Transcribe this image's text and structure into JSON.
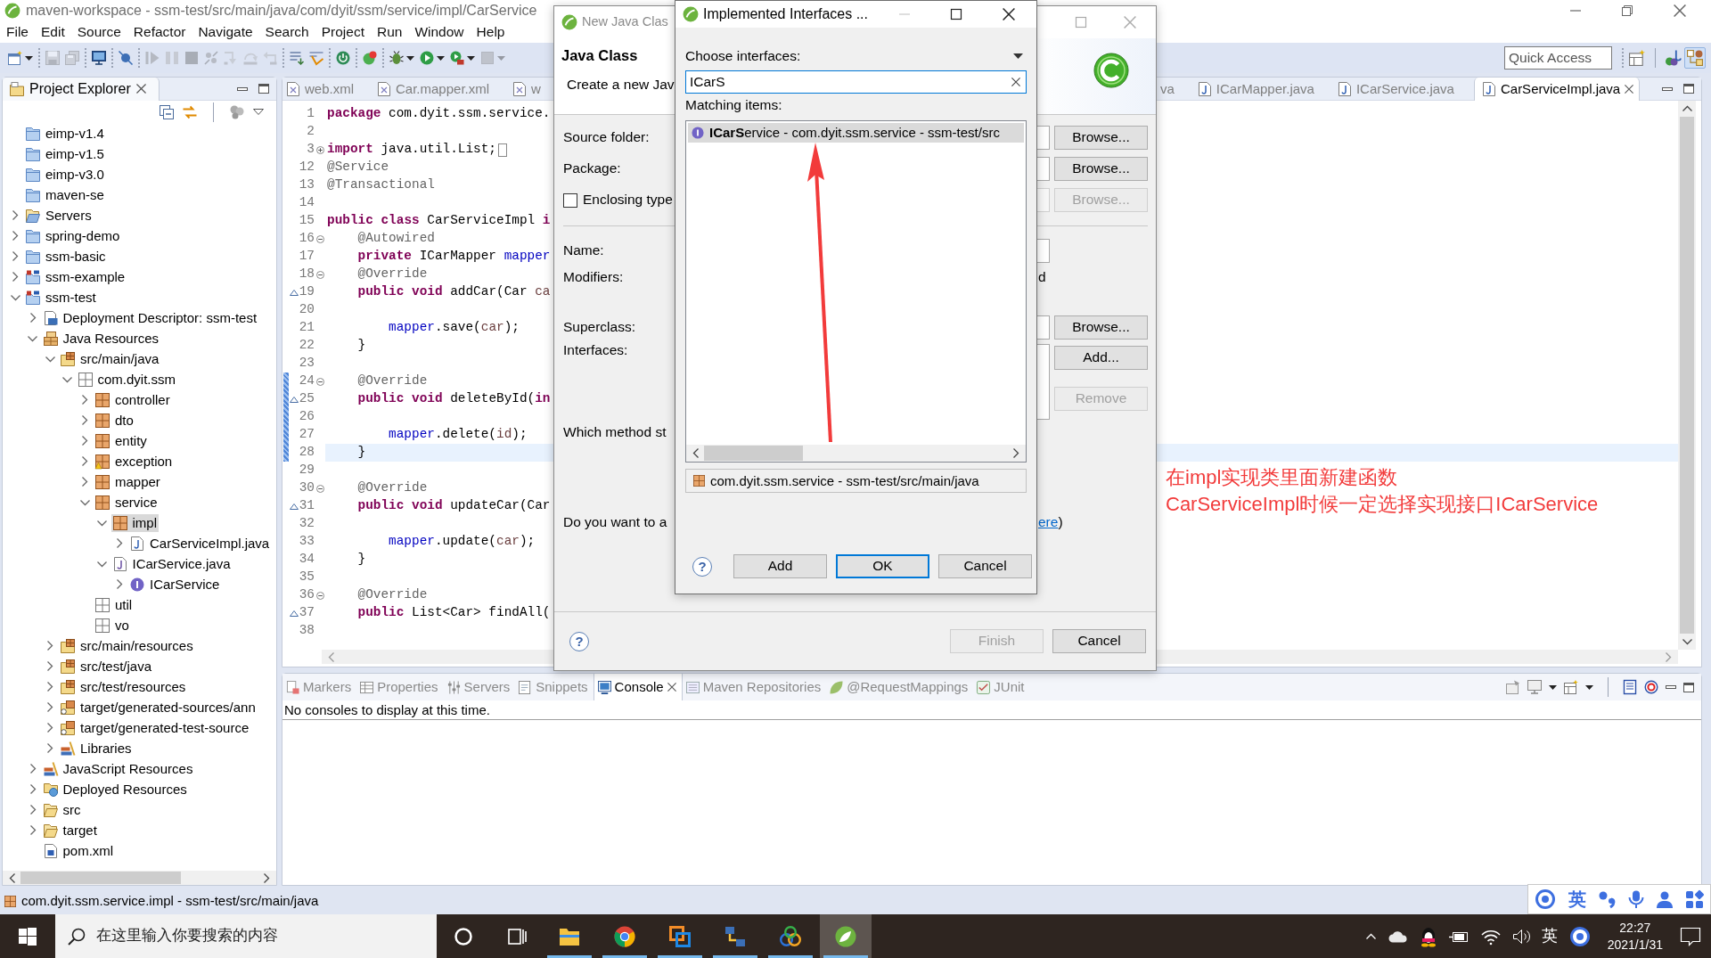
{
  "window": {
    "title": "maven-workspace - ssm-test/src/main/java/com/dyit/ssm/service/impl/CarService"
  },
  "menu": [
    "File",
    "Edit",
    "Source",
    "Refactor",
    "Navigate",
    "Search",
    "Project",
    "Run",
    "Window",
    "Help"
  ],
  "toolbar": [
    {
      "kind": "new",
      "dropdown": true,
      "disabled": false
    },
    {
      "kind": "separator"
    },
    {
      "kind": "save",
      "dropdown": false,
      "disabled": true
    },
    {
      "kind": "save-all",
      "dropdown": false,
      "disabled": true
    },
    {
      "kind": "separator"
    },
    {
      "kind": "terminal",
      "dropdown": false,
      "disabled": false
    },
    {
      "kind": "separator"
    },
    {
      "kind": "skip-breakpoints",
      "dropdown": false,
      "disabled": false
    },
    {
      "kind": "separator"
    },
    {
      "kind": "resume",
      "dropdown": false,
      "disabled": true
    },
    {
      "kind": "suspend",
      "dropdown": false,
      "disabled": true
    },
    {
      "kind": "terminate",
      "dropdown": false,
      "disabled": true
    },
    {
      "kind": "disconnect",
      "dropdown": false,
      "disabled": true
    },
    {
      "kind": "step-into",
      "dropdown": false,
      "disabled": true
    },
    {
      "kind": "step-over",
      "dropdown": false,
      "disabled": true
    },
    {
      "kind": "step-return",
      "dropdown": false,
      "disabled": true
    },
    {
      "kind": "separator"
    },
    {
      "kind": "drop-to-frame",
      "dropdown": false,
      "disabled": false
    },
    {
      "kind": "step-filters",
      "dropdown": false,
      "disabled": false
    },
    {
      "kind": "separator"
    },
    {
      "kind": "boot-dashboard",
      "dropdown": false,
      "disabled": false
    },
    {
      "kind": "separator"
    },
    {
      "kind": "spring-badge",
      "dropdown": false,
      "disabled": false
    },
    {
      "kind": "separator"
    },
    {
      "kind": "debug",
      "dropdown": true,
      "disabled": false
    },
    {
      "kind": "run",
      "dropdown": true,
      "disabled": false
    },
    {
      "kind": "external-tools",
      "dropdown": true,
      "disabled": false
    },
    {
      "kind": "stop-square",
      "dropdown": true,
      "disabled": true
    }
  ],
  "quick_access": {
    "placeholder": "Quick Access"
  },
  "perspectives": [
    {
      "kind": "open-perspective",
      "selected": false
    },
    {
      "kind": "java-ee",
      "selected": false
    },
    {
      "kind": "spring",
      "selected": true
    }
  ],
  "project_explorer": {
    "title": "Project Explorer",
    "tree": [
      {
        "label": "eimp-v1.4",
        "kind": "project",
        "selected": false
      },
      {
        "label": "eimp-v1.5",
        "kind": "project",
        "selected": false
      },
      {
        "label": "eimp-v3.0",
        "kind": "project",
        "selected": false
      },
      {
        "label": "maven-se",
        "kind": "project",
        "selected": false
      },
      {
        "label": "Servers",
        "kind": "servers",
        "expanded": false,
        "selected": false
      },
      {
        "label": "spring-demo",
        "kind": "project",
        "expanded": false,
        "selected": false
      },
      {
        "label": "ssm-basic",
        "kind": "project",
        "expanded": false,
        "selected": false
      },
      {
        "label": "ssm-example",
        "kind": "maven-project",
        "expanded": false,
        "selected": false
      },
      {
        "label": "ssm-test",
        "kind": "maven-project",
        "expanded": true,
        "selected": false,
        "children": [
          {
            "label": "Deployment Descriptor: ssm-test",
            "kind": "descriptor",
            "expanded": false,
            "selected": false
          },
          {
            "label": "Java Resources",
            "kind": "java-resources",
            "expanded": true,
            "selected": false,
            "children": [
              {
                "label": "src/main/java",
                "kind": "source-folder",
                "expanded": true,
                "selected": false,
                "children": [
                  {
                    "label": "com.dyit.ssm",
                    "kind": "empty-package",
                    "expanded": true,
                    "selected": false,
                    "children": [
                      {
                        "label": "controller",
                        "kind": "package",
                        "expanded": false,
                        "selected": false
                      },
                      {
                        "label": "dto",
                        "kind": "package",
                        "expanded": false,
                        "selected": false
                      },
                      {
                        "label": "entity",
                        "kind": "package",
                        "expanded": false,
                        "selected": false
                      },
                      {
                        "label": "exception",
                        "kind": "package-warning",
                        "expanded": false,
                        "selected": false
                      },
                      {
                        "label": "mapper",
                        "kind": "package",
                        "expanded": false,
                        "selected": false
                      },
                      {
                        "label": "service",
                        "kind": "package",
                        "expanded": true,
                        "selected": false,
                        "children": [
                          {
                            "label": "impl",
                            "kind": "package",
                            "expanded": true,
                            "selected": true,
                            "children": [
                              {
                                "label": "CarServiceImpl.java",
                                "kind": "java-file",
                                "expanded": false,
                                "selected": false
                              }
                            ]
                          },
                          {
                            "label": "ICarService.java",
                            "kind": "interface-file",
                            "expanded": true,
                            "selected": false,
                            "children": [
                              {
                                "label": "ICarService",
                                "kind": "interface",
                                "expanded": false,
                                "selected": false
                              }
                            ]
                          }
                        ]
                      },
                      {
                        "label": "util",
                        "kind": "empty-package",
                        "selected": false
                      },
                      {
                        "label": "vo",
                        "kind": "empty-package",
                        "selected": false
                      }
                    ]
                  }
                ]
              },
              {
                "label": "src/main/resources",
                "kind": "source-folder",
                "expanded": false,
                "selected": false
              },
              {
                "label": "src/test/java",
                "kind": "source-folder",
                "expanded": false,
                "selected": false
              },
              {
                "label": "src/test/resources",
                "kind": "source-folder",
                "expanded": false,
                "selected": false
              },
              {
                "label": "target/generated-sources/ann",
                "kind": "linked-source-folder",
                "expanded": false,
                "selected": false
              },
              {
                "label": "target/generated-test-source",
                "kind": "linked-source-folder",
                "expanded": false,
                "selected": false
              },
              {
                "label": "Libraries",
                "kind": "library",
                "expanded": false,
                "selected": false
              }
            ]
          },
          {
            "label": "JavaScript Resources",
            "kind": "library",
            "expanded": false,
            "selected": false
          },
          {
            "label": "Deployed Resources",
            "kind": "deployed",
            "expanded": false,
            "selected": false
          },
          {
            "label": "src",
            "kind": "folder",
            "expanded": false,
            "selected": false
          },
          {
            "label": "target",
            "kind": "folder",
            "expanded": false,
            "selected": false
          },
          {
            "label": "pom.xml",
            "kind": "pom",
            "selected": false
          }
        ]
      }
    ]
  },
  "editor": {
    "tabs_left": [
      {
        "label": "web.xml",
        "kind": "xml",
        "selected": false
      },
      {
        "label": "Car.mapper.xml",
        "kind": "xml",
        "selected": false
      },
      {
        "label": "w",
        "kind": "xml",
        "selected": false
      }
    ],
    "tabs_right": [
      {
        "label": "va",
        "selected": false
      },
      {
        "label": "ICarMapper.java",
        "kind": "java",
        "selected": false
      },
      {
        "label": "ICarService.java",
        "kind": "java",
        "selected": false
      },
      {
        "label": "CarServiceImpl.java",
        "kind": "java",
        "selected": true
      }
    ],
    "lines": [
      {
        "number": "1",
        "tokens": [
          {
            "kind": "keyword",
            "text": "package"
          },
          {
            "kind": "plain",
            "text": " com.dyit.ssm.service."
          }
        ]
      },
      {
        "number": "2"
      },
      {
        "number": "3",
        "collapsed": true,
        "tokens": [
          {
            "kind": "keyword",
            "text": "import"
          },
          {
            "kind": "plain",
            "text": " java.util.List;"
          }
        ]
      },
      {
        "number": "12",
        "tokens": [
          {
            "kind": "annotation",
            "text": "@Service"
          }
        ]
      },
      {
        "number": "13",
        "tokens": [
          {
            "kind": "annotation",
            "text": "@Transactional"
          }
        ]
      },
      {
        "number": "14"
      },
      {
        "number": "15",
        "tokens": [
          {
            "kind": "keyword",
            "text": "public"
          },
          {
            "kind": "keyword",
            "text": " class"
          },
          {
            "kind": "plain",
            "text": " CarServiceImpl"
          },
          {
            "kind": "keyword",
            "text": " i"
          }
        ]
      },
      {
        "number": "16",
        "collapsed": false,
        "tokens": [
          {
            "kind": "annotation",
            "text": "    @Autowired"
          }
        ]
      },
      {
        "number": "17",
        "tokens": [
          {
            "kind": "keyword",
            "text": "    private"
          },
          {
            "kind": "plain",
            "text": " ICarMapper"
          },
          {
            "kind": "field",
            "text": " mapper"
          }
        ]
      },
      {
        "number": "18",
        "collapsed": false,
        "tokens": [
          {
            "kind": "annotation",
            "text": "    @Override"
          }
        ]
      },
      {
        "number": "19",
        "override": true,
        "tokens": [
          {
            "kind": "keyword",
            "text": "    public"
          },
          {
            "kind": "keyword",
            "text": " void"
          },
          {
            "kind": "plain",
            "text": " addCar(Car"
          },
          {
            "kind": "local",
            "text": " ca"
          }
        ]
      },
      {
        "number": "20"
      },
      {
        "number": "21",
        "tokens": [
          {
            "kind": "field",
            "text": "        mapper"
          },
          {
            "kind": "plain",
            "text": ".save("
          },
          {
            "kind": "local",
            "text": "car"
          },
          {
            "kind": "plain",
            "text": ");"
          }
        ]
      },
      {
        "number": "22",
        "tokens": [
          {
            "kind": "plain",
            "text": "    }"
          }
        ]
      },
      {
        "number": "23"
      },
      {
        "number": "24",
        "collapsed": false,
        "changed": true,
        "tokens": [
          {
            "kind": "annotation",
            "text": "    @Override"
          }
        ]
      },
      {
        "number": "25",
        "override": true,
        "changed": true,
        "tokens": [
          {
            "kind": "keyword",
            "text": "    public"
          },
          {
            "kind": "keyword",
            "text": " void"
          },
          {
            "kind": "plain",
            "text": " deleteById("
          },
          {
            "kind": "keyword",
            "text": "in"
          }
        ]
      },
      {
        "number": "26",
        "changed": true
      },
      {
        "number": "27",
        "changed": true,
        "tokens": [
          {
            "kind": "field",
            "text": "        mapper"
          },
          {
            "kind": "plain",
            "text": ".delete("
          },
          {
            "kind": "local",
            "text": "id"
          },
          {
            "kind": "plain",
            "text": ");"
          }
        ]
      },
      {
        "number": "28",
        "changed": true,
        "current": true,
        "tokens": [
          {
            "kind": "plain",
            "text": "    }"
          }
        ]
      },
      {
        "number": "29"
      },
      {
        "number": "30",
        "collapsed": false,
        "tokens": [
          {
            "kind": "annotation",
            "text": "    @Override"
          }
        ]
      },
      {
        "number": "31",
        "override": true,
        "tokens": [
          {
            "kind": "keyword",
            "text": "    public"
          },
          {
            "kind": "keyword",
            "text": " void"
          },
          {
            "kind": "plain",
            "text": " updateCar(Car"
          }
        ]
      },
      {
        "number": "32"
      },
      {
        "number": "33",
        "tokens": [
          {
            "kind": "field",
            "text": "        mapper"
          },
          {
            "kind": "plain",
            "text": ".update("
          },
          {
            "kind": "local",
            "text": "car"
          },
          {
            "kind": "plain",
            "text": ");"
          }
        ]
      },
      {
        "number": "34",
        "tokens": [
          {
            "kind": "plain",
            "text": "    }"
          }
        ]
      },
      {
        "number": "35"
      },
      {
        "number": "36",
        "collapsed": false,
        "tokens": [
          {
            "kind": "annotation",
            "text": "    @Override"
          }
        ]
      },
      {
        "number": "37",
        "override": true,
        "tokens": [
          {
            "kind": "keyword",
            "text": "    public"
          },
          {
            "kind": "plain",
            "text": " List<Car> findAll("
          }
        ]
      },
      {
        "number": "38"
      }
    ]
  },
  "bottom_panel": {
    "tabs": [
      {
        "label": "Markers",
        "kind": "markers",
        "selected": false
      },
      {
        "label": "Properties",
        "kind": "properties",
        "selected": false
      },
      {
        "label": "Servers",
        "kind": "servers",
        "selected": false
      },
      {
        "label": "Snippets",
        "kind": "snippets",
        "selected": false
      },
      {
        "label": "Console",
        "kind": "console",
        "selected": true
      },
      {
        "label": "Maven Repositories",
        "kind": "maven",
        "selected": false
      },
      {
        "label": "@RequestMappings",
        "kind": "mappings",
        "selected": false
      },
      {
        "label": "JUnit",
        "kind": "junit",
        "selected": false
      }
    ],
    "message": "No consoles to display at this time."
  },
  "status_bar": {
    "text": "com.dyit.ssm.service.impl - ssm-test/src/main/java"
  },
  "new_java_class_dialog": {
    "title": "New Java Clas",
    "heading": "Java Class",
    "description": "Create a new Jav",
    "rows": [
      {
        "kind": "field",
        "label": "Source folder:",
        "button": {
          "label": "Browse...",
          "disabled": false
        }
      },
      {
        "kind": "field",
        "label": "Package:",
        "button": {
          "label": "Browse...",
          "disabled": false
        }
      },
      {
        "kind": "checkbox",
        "label": "Enclosing type",
        "checked": false,
        "button": {
          "label": "Browse...",
          "disabled": true
        }
      },
      {
        "kind": "separator"
      },
      {
        "kind": "field",
        "label": "Name:"
      },
      {
        "kind": "text",
        "label": "Modifiers:",
        "right_text": "d"
      },
      {
        "kind": "field",
        "label": "Superclass:",
        "button": {
          "label": "Browse...",
          "disabled": false
        }
      },
      {
        "kind": "list",
        "label": "Interfaces:",
        "buttons": [
          {
            "label": "Add...",
            "disabled": false
          },
          {
            "label": "Remove",
            "disabled": true
          }
        ]
      },
      {
        "kind": "text",
        "label": "Which method st"
      },
      {
        "kind": "link",
        "label": "Do you want to a",
        "link_text": "ere",
        "right_text": ")"
      }
    ],
    "help": "?",
    "footer_buttons": [
      {
        "label": "Finish",
        "disabled": true
      },
      {
        "label": "Cancel",
        "disabled": false
      }
    ]
  },
  "implemented_interfaces_dialog": {
    "title": "Implemented Interfaces ...",
    "filter_label": "Choose interfaces:",
    "filter": {
      "value": "ICarS"
    },
    "matches_label": "Matching items:",
    "matches": [
      {
        "text": "**ICarS**ervice - com.dyit.ssm.service - ssm-test/src",
        "selected": true
      }
    ],
    "location": "com.dyit.ssm.service - ssm-test/src/main/java",
    "help": "?",
    "buttons": [
      {
        "label": "Add",
        "default": false
      },
      {
        "label": "OK",
        "default": true
      },
      {
        "label": "Cancel",
        "default": false
      }
    ]
  },
  "annotation": {
    "lines": [
      "在impl实现类里面新建函数",
      "CarServiceImpl时候一定选择实现接口ICarService"
    ]
  },
  "ime_toolbar": {
    "language": "英"
  },
  "taskbar": {
    "search_placeholder": "在这里输入你要搜索的内容",
    "apps": [
      {
        "kind": "file-explorer",
        "running": true,
        "active": false
      },
      {
        "kind": "browser",
        "running": true,
        "active": false
      },
      {
        "kind": "squares-app",
        "running": true,
        "active": false
      },
      {
        "kind": "network-app",
        "running": true,
        "active": false
      },
      {
        "kind": "rings-app",
        "running": true,
        "active": false
      },
      {
        "kind": "spring-app",
        "running": true,
        "active": true
      }
    ],
    "tray_language": "英",
    "time": "22:27",
    "date": "2021/1/31"
  }
}
